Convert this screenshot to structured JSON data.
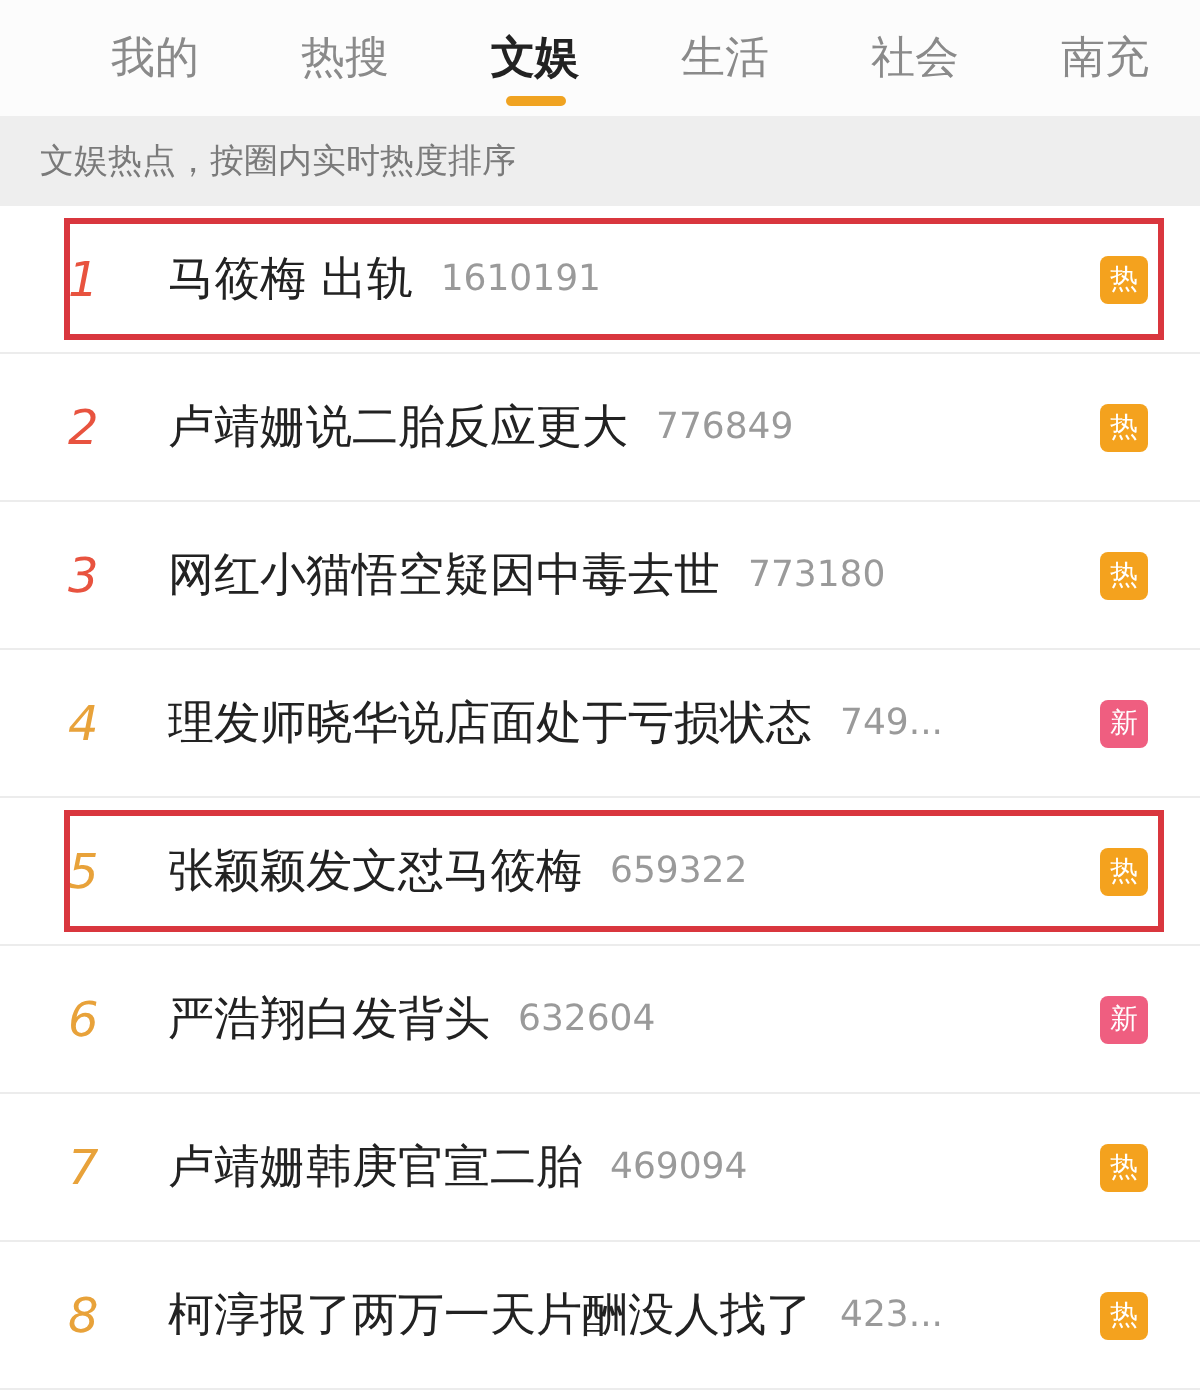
{
  "tabs": [
    {
      "label": "我的",
      "selected": false
    },
    {
      "label": "热搜",
      "selected": false
    },
    {
      "label": "文娱",
      "selected": true
    },
    {
      "label": "生活",
      "selected": false
    },
    {
      "label": "社会",
      "selected": false
    },
    {
      "label": "南充",
      "selected": false
    }
  ],
  "subtitle": "文娱热点，按圈内实时热度排序",
  "rows": [
    {
      "rank": "1",
      "color": "#e8533f",
      "title": "马筱梅 出轨",
      "count": "1610191",
      "badge": {
        "kind": "hot",
        "label": "热"
      },
      "highlighted": true
    },
    {
      "rank": "2",
      "color": "#e8533f",
      "title": "卢靖姗说二胎反应更大",
      "count": "776849",
      "badge": {
        "kind": "hot",
        "label": "热"
      },
      "highlighted": false
    },
    {
      "rank": "3",
      "color": "#e8533f",
      "title": "网红小猫悟空疑因中毒去世",
      "count": "773180",
      "badge": {
        "kind": "hot",
        "label": "热"
      },
      "highlighted": false
    },
    {
      "rank": "4",
      "color": "#e8a23a",
      "title": "理发师晓华说店面处于亏损状态",
      "count": "749...",
      "badge": {
        "kind": "new",
        "label": "新"
      },
      "highlighted": false
    },
    {
      "rank": "5",
      "color": "#e8a23a",
      "title": "张颖颖发文怼马筱梅",
      "count": "659322",
      "badge": {
        "kind": "hot",
        "label": "热"
      },
      "highlighted": true
    },
    {
      "rank": "6",
      "color": "#e8a23a",
      "title": "严浩翔白发背头",
      "count": "632604",
      "badge": {
        "kind": "new",
        "label": "新"
      },
      "highlighted": false
    },
    {
      "rank": "7",
      "color": "#e8a23a",
      "title": "卢靖姗韩庚官宣二胎",
      "count": "469094",
      "badge": {
        "kind": "hot",
        "label": "热"
      },
      "highlighted": false
    },
    {
      "rank": "8",
      "color": "#e8a23a",
      "title": "柯淳报了两万一天片酬没人找了",
      "count": "423...",
      "badge": {
        "kind": "hot",
        "label": "热"
      },
      "highlighted": false
    }
  ]
}
